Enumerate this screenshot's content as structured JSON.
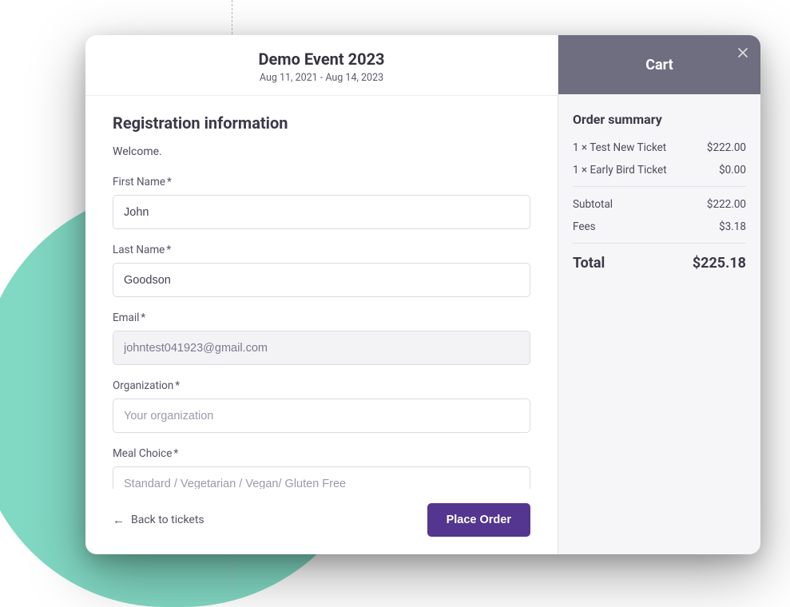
{
  "header": {
    "title": "Demo Event 2023",
    "dates": "Aug 11, 2021 - Aug 14, 2023"
  },
  "form": {
    "section_title": "Registration information",
    "welcome": "Welcome.",
    "fields": {
      "first_name": {
        "label": "First Name",
        "value": "John",
        "required": true
      },
      "last_name": {
        "label": "Last Name",
        "value": "Goodson",
        "required": true
      },
      "email": {
        "label": "Email",
        "value": "johntest041923@gmail.com",
        "required": true
      },
      "organization": {
        "label": "Organization",
        "placeholder": "Your organization",
        "required": true
      },
      "meal_choice": {
        "label": "Meal Choice",
        "placeholder": "Standard / Vegetarian / Vegan/ Gluten Free",
        "required": true
      }
    }
  },
  "footer": {
    "back_label": "Back to tickets",
    "place_order_label": "Place Order"
  },
  "cart": {
    "title": "Cart",
    "summary_title": "Order summary",
    "items": [
      {
        "label": "1 × Test New Ticket",
        "amount": "$222.00"
      },
      {
        "label": "1 × Early Bird Ticket",
        "amount": "$0.00"
      }
    ],
    "subtotal": {
      "label": "Subtotal",
      "amount": "$222.00"
    },
    "fees": {
      "label": "Fees",
      "amount": "$3.18"
    },
    "total": {
      "label": "Total",
      "amount": "$225.18"
    }
  }
}
